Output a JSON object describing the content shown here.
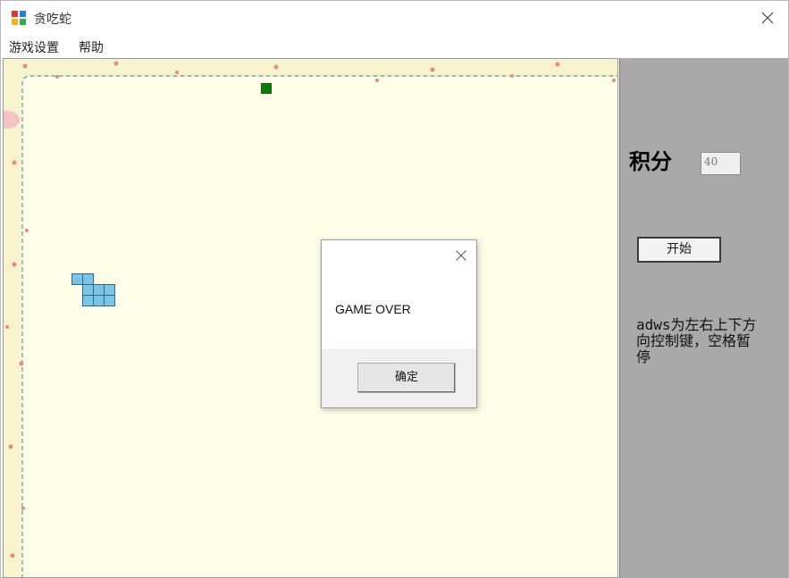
{
  "window": {
    "title": "贪吃蛇"
  },
  "menu": {
    "items": [
      "游戏设置",
      "帮助"
    ]
  },
  "side_panel": {
    "score_label": "积分",
    "score_value": "40",
    "start_label": "开始",
    "help_text": "adws为左右上下方向控制键，空格暂停"
  },
  "dialog": {
    "message": "GAME OVER",
    "ok_label": "确定"
  },
  "colors": {
    "board_bg": "#fdfde8",
    "side_bg": "#a9a9a9",
    "snake": "#7cc4e6",
    "food": "#0a7a0a"
  },
  "icons": {
    "app": "app-grid-icon",
    "close": "close-icon"
  }
}
